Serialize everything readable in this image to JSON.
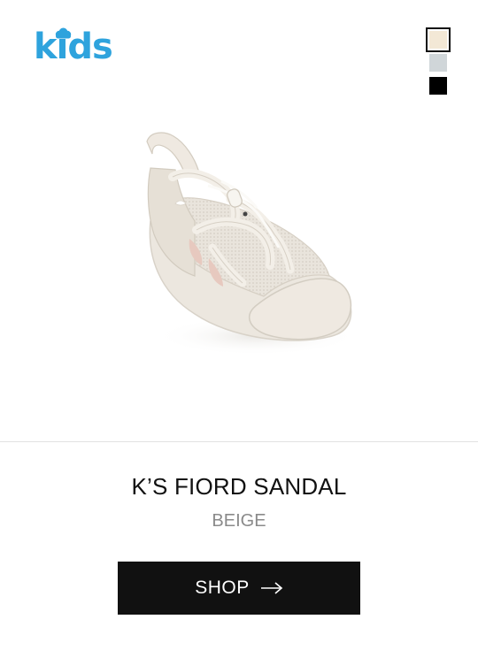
{
  "brand": {
    "logo_text": "kids",
    "logo_color": "#2ea3dd"
  },
  "swatches": [
    {
      "name": "beige",
      "color": "#f3e8d6",
      "selected": true
    },
    {
      "name": "grey",
      "color": "#d0d6d9",
      "selected": false
    },
    {
      "name": "black",
      "color": "#000000",
      "selected": false
    }
  ],
  "product": {
    "image_icon": "sandal-image",
    "title": "K’S FIORD SANDAL",
    "color": "BEIGE"
  },
  "cta": {
    "label": "SHOP",
    "icon": "arrow-right-icon",
    "background": "#111111"
  }
}
